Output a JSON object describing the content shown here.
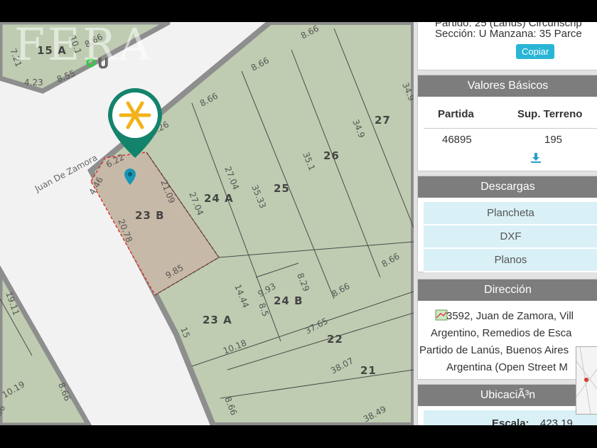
{
  "watermark": "FERA",
  "map": {
    "street": "Juan De Zamora",
    "marker_label": "U",
    "lots": {
      "l15a": "15 A",
      "l23b": "23 B",
      "l24a": "24 A",
      "l25": "25",
      "l26": "26",
      "l27": "27",
      "l23a": "23 A",
      "l24b": "24 B",
      "l22": "22",
      "l21": "21"
    },
    "dims": {
      "d1": "10.1",
      "d2": "8.66",
      "d3": "7.21",
      "d4": "4.23",
      "d5": "8.55",
      "d6": "8.66",
      "d7": "8.66",
      "d8": "8.66",
      "d9": "34.9",
      "d10": "34.9",
      "d11": "6.26",
      "d12": "6.22",
      "d13": "4.46",
      "d14": "21.09",
      "d15": "27.04",
      "d16": "27.04",
      "d17": "35.33",
      "d18": "35.1",
      "d19": "20.78",
      "d20": "9.85",
      "d21": "8.66",
      "d22": "14.44",
      "d23": "9.93",
      "d24": "8.5",
      "d25": "8.29",
      "d26": "8.66",
      "d27": "15",
      "d28": "37.65",
      "d29": "10.18",
      "d30": "38.07",
      "d31": "8.66",
      "d32": "38.49",
      "d33": "19.11",
      "d34": "10.19",
      "d35": "8.66",
      "d36": "86"
    }
  },
  "panel": {
    "header_text": {
      "line1": "Partido: 25 (Lanús) Circunscrip",
      "line2": "Sección: U Manzana: 35 Parce",
      "copy_label": "Copiar"
    },
    "valores": {
      "title": "Valores Básicos",
      "col1_header": "Partida",
      "col2_header": "Sup. Terreno",
      "partida": "46895",
      "sup_terreno": "195"
    },
    "descargas": {
      "title": "Descargas",
      "items": [
        "Plancheta",
        "DXF",
        "Planos"
      ]
    },
    "direccion": {
      "title": "Dirección",
      "lines": [
        "3592, Juan de Zamora, Vill",
        "Argentino, Remedios de Esca",
        "Partido de Lanús, Buenos Aires",
        "Argentina (Open Street M"
      ]
    },
    "ubicacion": {
      "title": "UbicaciÃ³n",
      "escala_label": "Escala:",
      "escala_value": "423.19"
    }
  }
}
